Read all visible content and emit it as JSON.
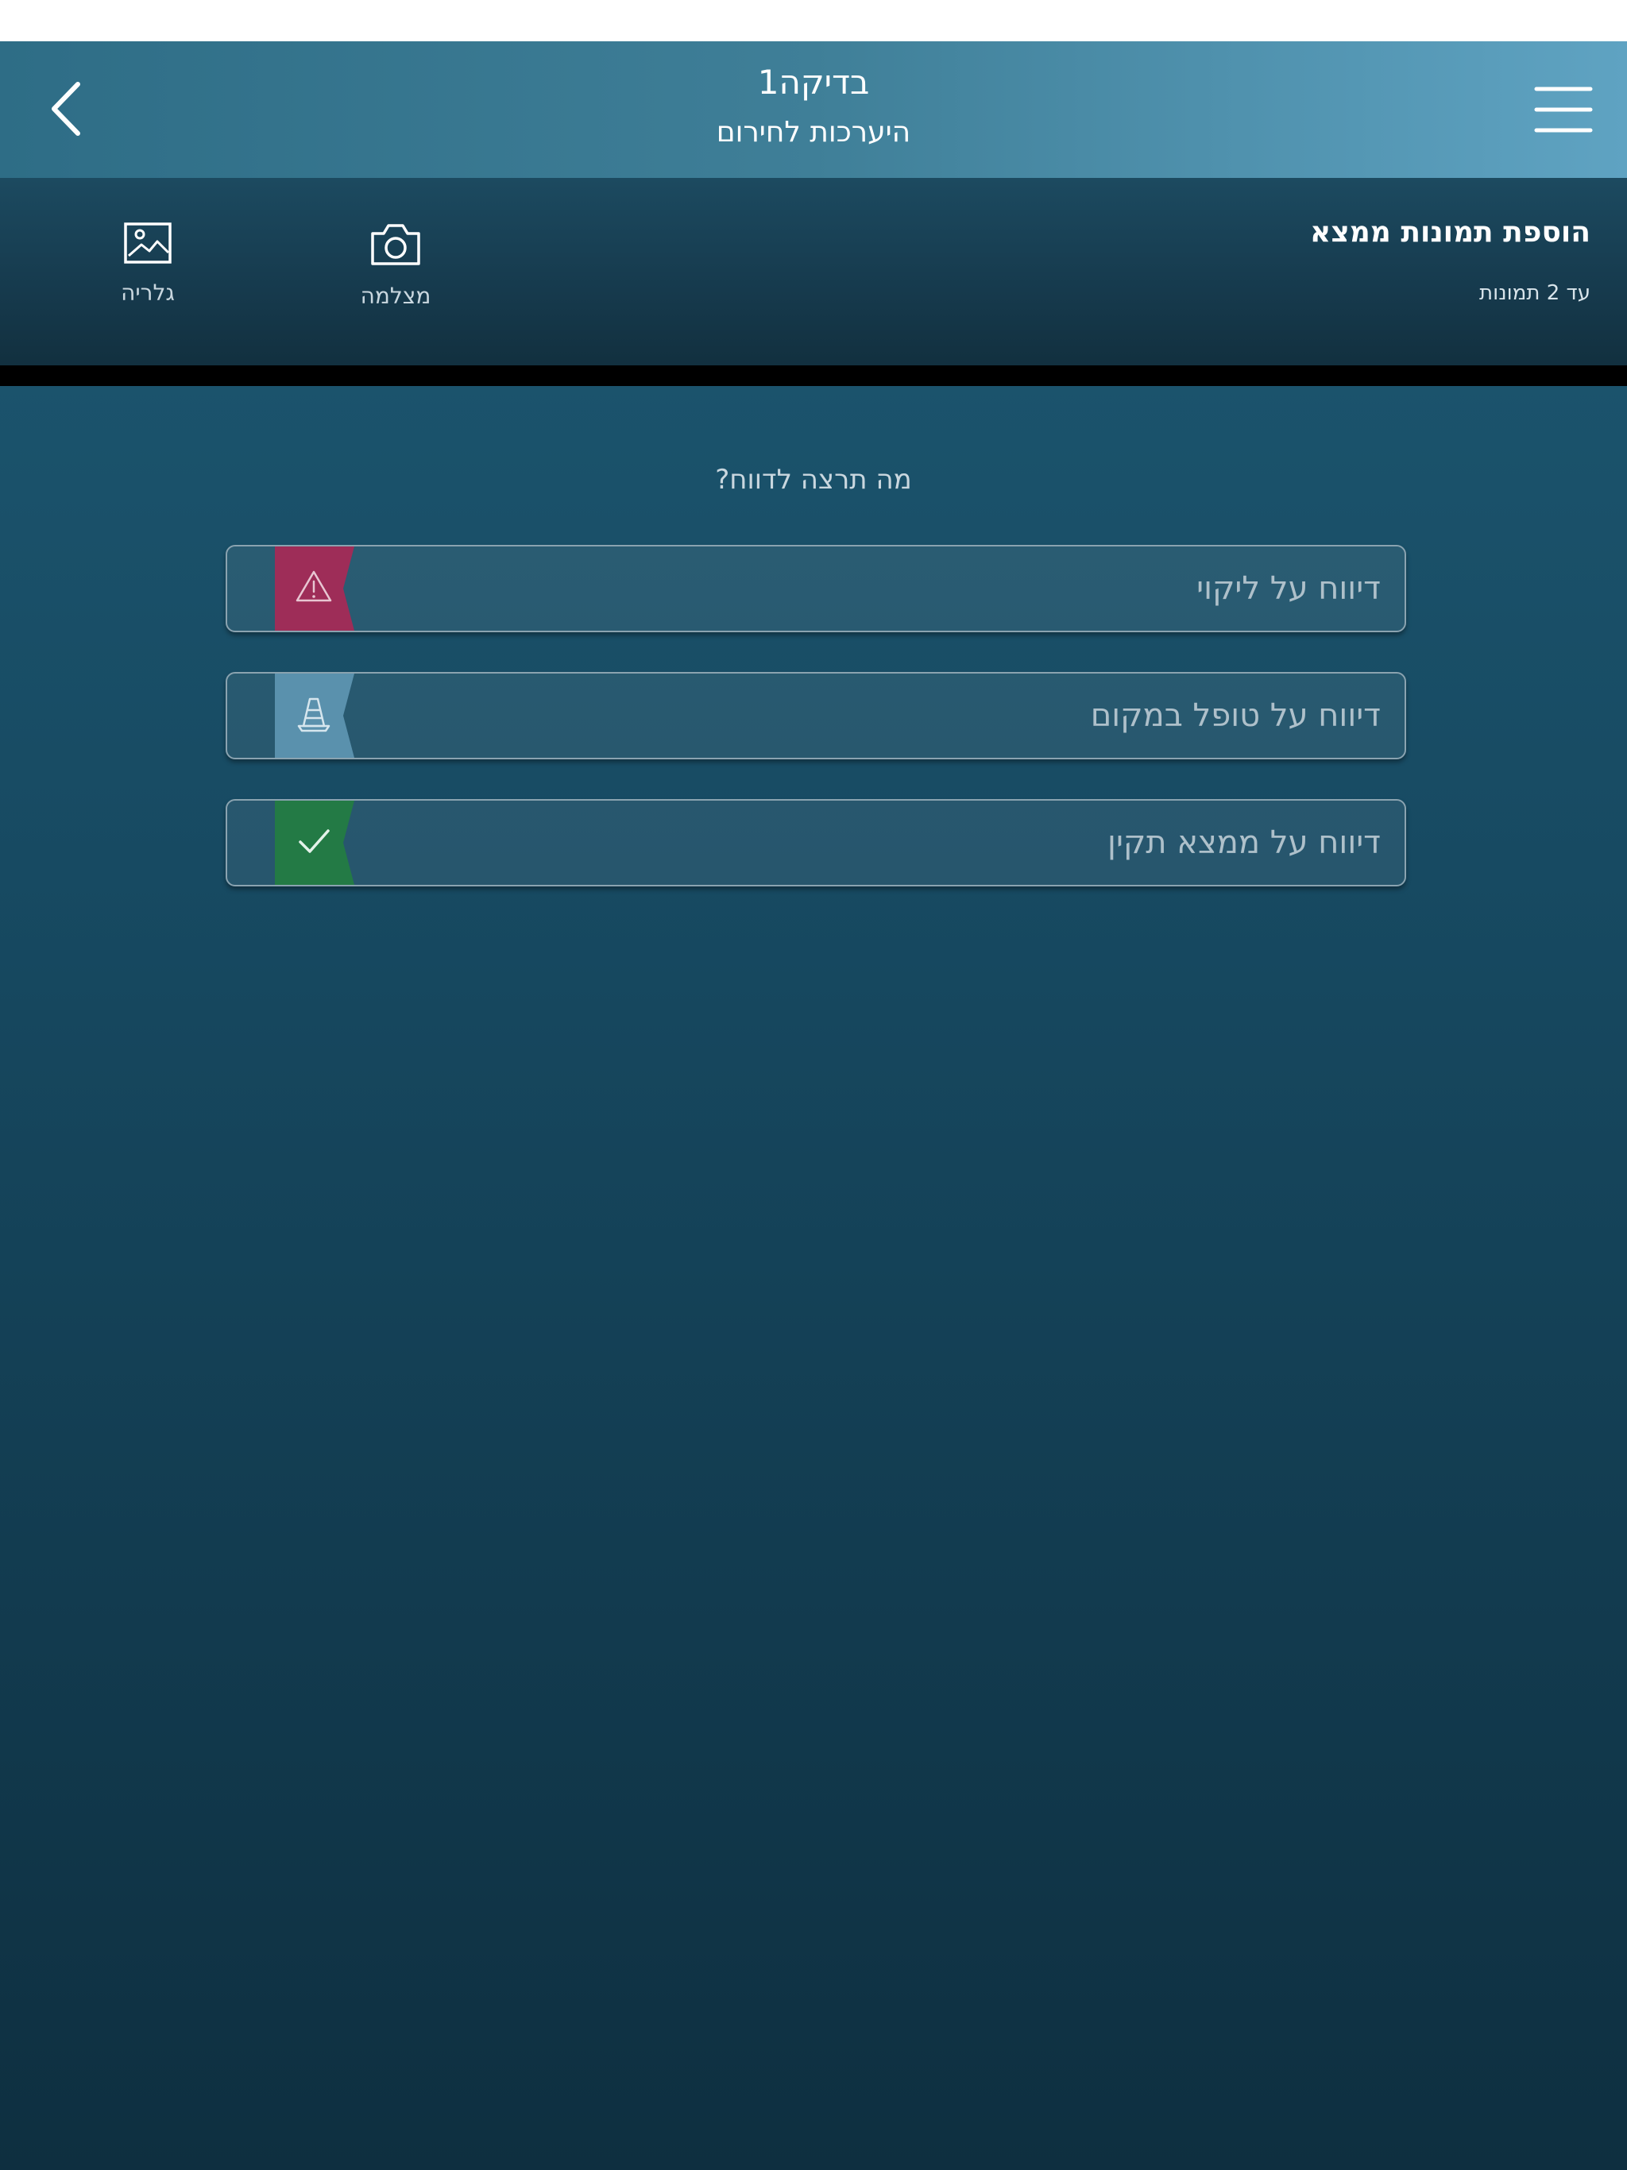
{
  "nav": {
    "title": "בדיקה1",
    "subtitle": "היערכות לחירום",
    "back_icon": "chevron-left-icon",
    "menu_icon": "hamburger-menu-icon"
  },
  "photos": {
    "title": "הוספת תמונות ממצא",
    "limit": "עד 2 תמונות",
    "camera_label": "מצלמה",
    "gallery_label": "גלריה"
  },
  "question": "מה תרצה לדווח?",
  "reports": [
    {
      "label": "דיווח על ליקוי",
      "icon": "warning-triangle-icon",
      "color": "#9e2d58"
    },
    {
      "label": "דיווח על טופל במקום",
      "icon": "traffic-cone-icon",
      "color": "#5a91ad"
    },
    {
      "label": "דיווח על ממצא תקין",
      "icon": "checkmark-icon",
      "color": "#237a45"
    }
  ],
  "colors": {
    "status_bar": "#ffffff",
    "background": "#174a62",
    "nav_bar": "#3f7f98"
  }
}
